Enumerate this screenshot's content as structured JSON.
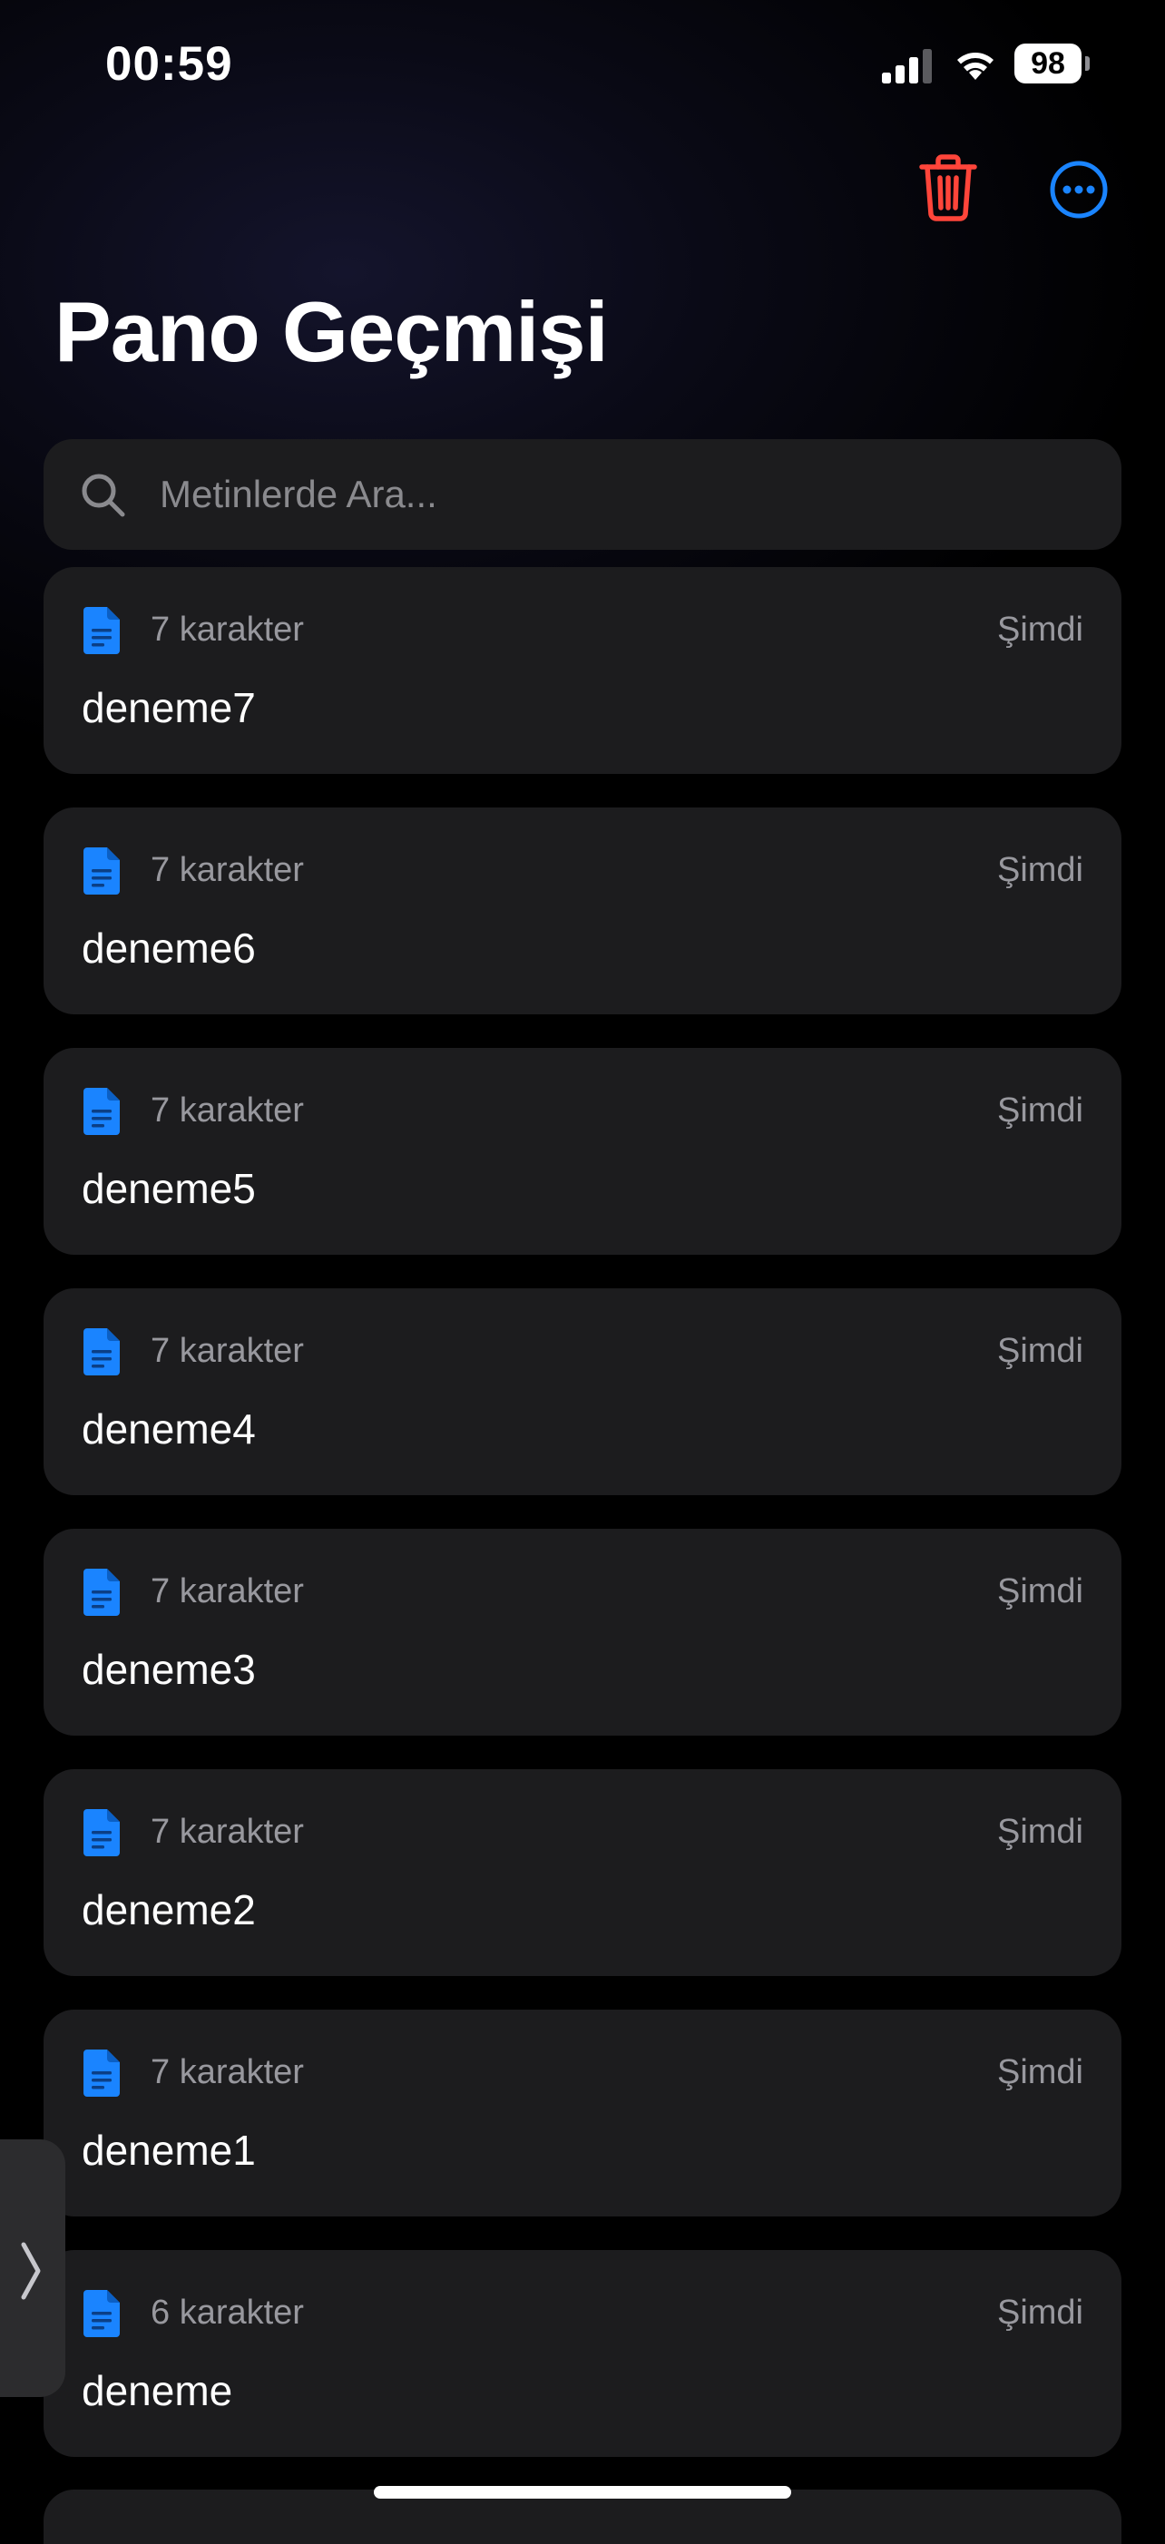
{
  "status_bar": {
    "time": "00:59",
    "battery_level": "98",
    "signal_icon": "cellular-signal-icon",
    "wifi_icon": "wifi-icon"
  },
  "toolbar": {
    "trash_icon": "trash-icon",
    "more_icon": "ellipsis-circle-icon"
  },
  "colors": {
    "accent_blue": "#1a84ff",
    "destructive_red": "#ff453a",
    "card_background": "#1c1c1e",
    "secondary_text": "#98989e"
  },
  "page": {
    "title": "Pano Geçmişi"
  },
  "search": {
    "placeholder": "Metinlerde Ara...",
    "value": ""
  },
  "clips": [
    {
      "char_count": "7 karakter",
      "time": "Şimdi",
      "text": "deneme7"
    },
    {
      "char_count": "7 karakter",
      "time": "Şimdi",
      "text": "deneme6"
    },
    {
      "char_count": "7 karakter",
      "time": "Şimdi",
      "text": "deneme5"
    },
    {
      "char_count": "7 karakter",
      "time": "Şimdi",
      "text": "deneme4"
    },
    {
      "char_count": "7 karakter",
      "time": "Şimdi",
      "text": "deneme3"
    },
    {
      "char_count": "7 karakter",
      "time": "Şimdi",
      "text": "deneme2"
    },
    {
      "char_count": "7 karakter",
      "time": "Şimdi",
      "text": "deneme1"
    },
    {
      "char_count": "6 karakter",
      "time": "Şimdi",
      "text": "deneme"
    }
  ]
}
